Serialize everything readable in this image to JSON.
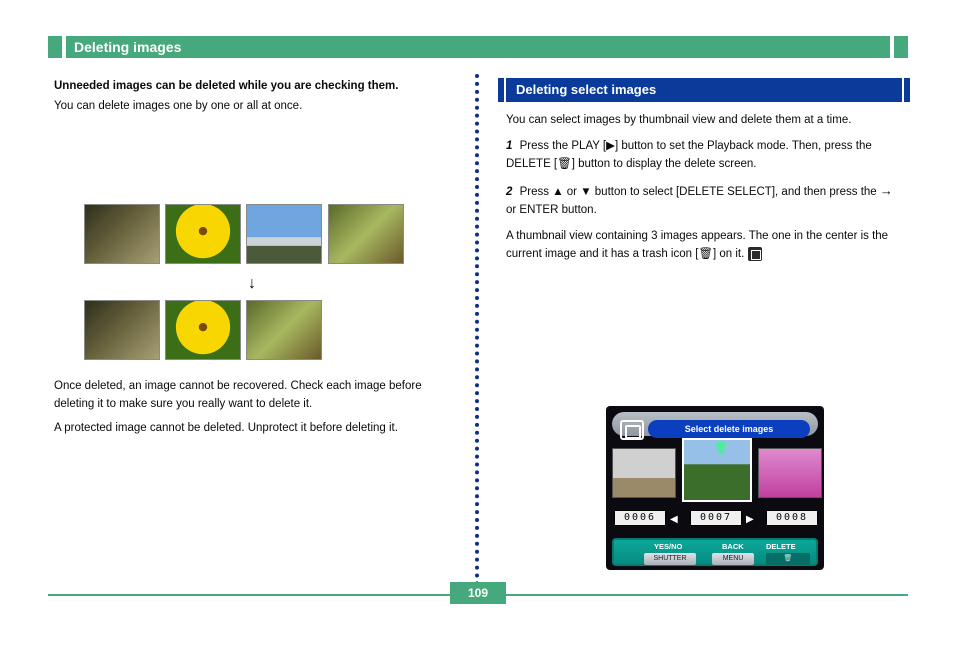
{
  "header": {
    "title": "Deleting images"
  },
  "left": {
    "intro_heading": "Unneeded images can be deleted while you are checking them.",
    "intro_body": "You can delete images one by one or all at once.",
    "after_thumbs": "Once deleted, an image cannot be recovered. Check each image before deleting it to make sure you really want to delete it.",
    "note": "A protected image cannot be deleted. Unprotect it before deleting it."
  },
  "right": {
    "blue_title": "Deleting select images",
    "lead": "You can select images by thumbnail view and delete them at a time.",
    "step1_num": "1",
    "step1_text": "Press the PLAY [▶] button to set the Playback mode. Then, press the DELETE [🗑] button to display the delete screen.",
    "step2_num": "2",
    "step2_a": "Press ▲ or ▼ button to select [DELETE SELECT], ",
    "step2_b": "and then press the ",
    "step2_arrow": "→",
    "step2_c": " or ENTER button.",
    "step2_trail": "A thumbnail view containing 3 images appears. The one in the center is the current image and it has a trash icon [🗑] on it.",
    "counters": {
      "c1": "0006",
      "c2": "0007",
      "c3": "0008"
    },
    "lcd": {
      "header": "Select delete images",
      "action_labels": {
        "yesno": "YES/NO",
        "back": "BACK",
        "delete": "DELETE"
      },
      "action_buttons": {
        "shutter": "SHUTTER",
        "menu": "MENU",
        "trash": "🗑"
      }
    }
  },
  "page_number": "109"
}
